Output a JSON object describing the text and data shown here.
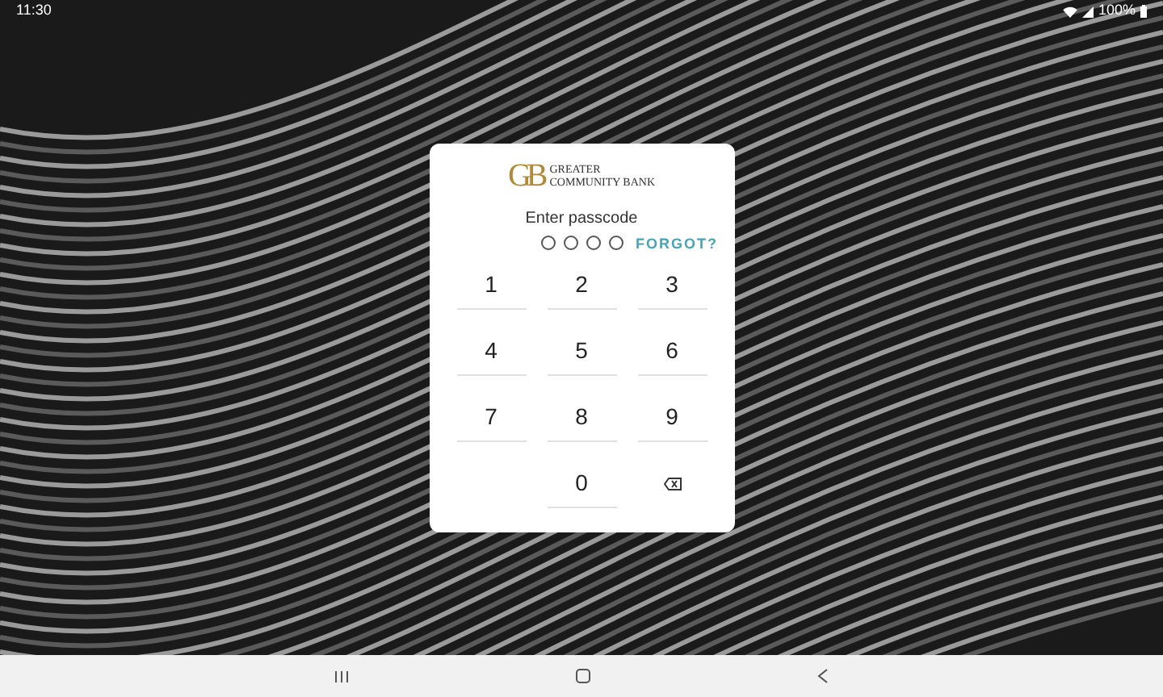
{
  "status_bar": {
    "time": "11:30",
    "battery": "100%"
  },
  "logo": {
    "monogram": "GB",
    "line_1": "GREATER",
    "line_2": "COMMUNITY BANK"
  },
  "prompt": "Enter passcode",
  "passcode_dots": [
    {
      "filled": false
    },
    {
      "filled": false
    },
    {
      "filled": false
    },
    {
      "filled": false
    }
  ],
  "forgot_link": "FORGOT?",
  "keypad": [
    {
      "kind": "digit",
      "label": "1"
    },
    {
      "kind": "digit",
      "label": "2"
    },
    {
      "kind": "digit",
      "label": "3"
    },
    {
      "kind": "digit",
      "label": "4"
    },
    {
      "kind": "digit",
      "label": "5"
    },
    {
      "kind": "digit",
      "label": "6"
    },
    {
      "kind": "digit",
      "label": "7"
    },
    {
      "kind": "digit",
      "label": "8"
    },
    {
      "kind": "digit",
      "label": "9"
    },
    {
      "kind": "blank"
    },
    {
      "kind": "digit",
      "label": "0"
    },
    {
      "kind": "backspace"
    }
  ]
}
